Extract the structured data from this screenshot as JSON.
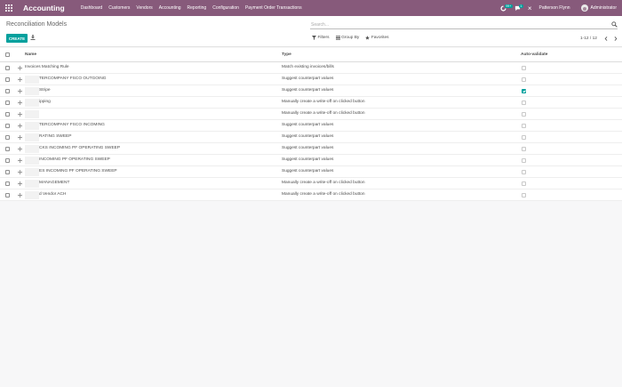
{
  "navbar": {
    "brand": "Accounting",
    "menu": [
      "Dashboard",
      "Customers",
      "Vendors",
      "Accounting",
      "Reporting",
      "Configuration",
      "Payment Order Transactions"
    ],
    "chat_badge": "99+",
    "activity_badge": "1",
    "company": "Patterson Flynn",
    "user": "Administrator",
    "colors": {
      "bar": "#875a7b",
      "accent": "#00a09d"
    }
  },
  "control": {
    "title": "Reconciliation Models",
    "search_placeholder": "Search...",
    "create_label": "CREATE",
    "filters_label": "Filters",
    "groupby_label": "Group By",
    "favorites_label": "Favorites",
    "pager": "1-12 / 12"
  },
  "table": {
    "headers": {
      "name": "Name",
      "type": "Type",
      "auto": "Auto-validate"
    },
    "rows": [
      {
        "name": "Invoices Matching Rule",
        "type": "Match existing invoices/bills",
        "auto": false,
        "redacted": false
      },
      {
        "name": "TERCOMPANY FSCO OUTGOING",
        "type": "Suggest counterpart values",
        "auto": false,
        "redacted": true
      },
      {
        "name": "Stripe",
        "type": "Suggest counterpart values",
        "auto": true,
        "redacted": true
      },
      {
        "name": "ipping",
        "type": "Manually create a write-off on clicked button",
        "auto": false,
        "redacted": true
      },
      {
        "name": "",
        "type": "Manually create a write-off on clicked button",
        "auto": false,
        "redacted": true
      },
      {
        "name": "TERCOMPANY FSCO INCOMING",
        "type": "Suggest counterpart values",
        "auto": false,
        "redacted": true
      },
      {
        "name": "RATING SWEEP",
        "type": "Suggest counterpart values",
        "auto": false,
        "redacted": true
      },
      {
        "name": "CKS INCOMING PF OPERATING SWEEP",
        "type": "Suggest counterpart values",
        "auto": false,
        "redacted": true
      },
      {
        "name": "INCOMING PF OPERATING SWEEP",
        "type": "Suggest counterpart values",
        "auto": false,
        "redacted": true
      },
      {
        "name": "ES INCOMING PF OPERATING SWEEP",
        "type": "Suggest counterpart values",
        "auto": false,
        "redacted": true
      },
      {
        "name": "MANAGEMENT",
        "type": "Manually create a write-off on clicked button",
        "auto": false,
        "redacted": true
      },
      {
        "name": "d Vendor ACH",
        "type": "Manually create a write-off on clicked button",
        "auto": false,
        "redacted": true
      }
    ]
  }
}
